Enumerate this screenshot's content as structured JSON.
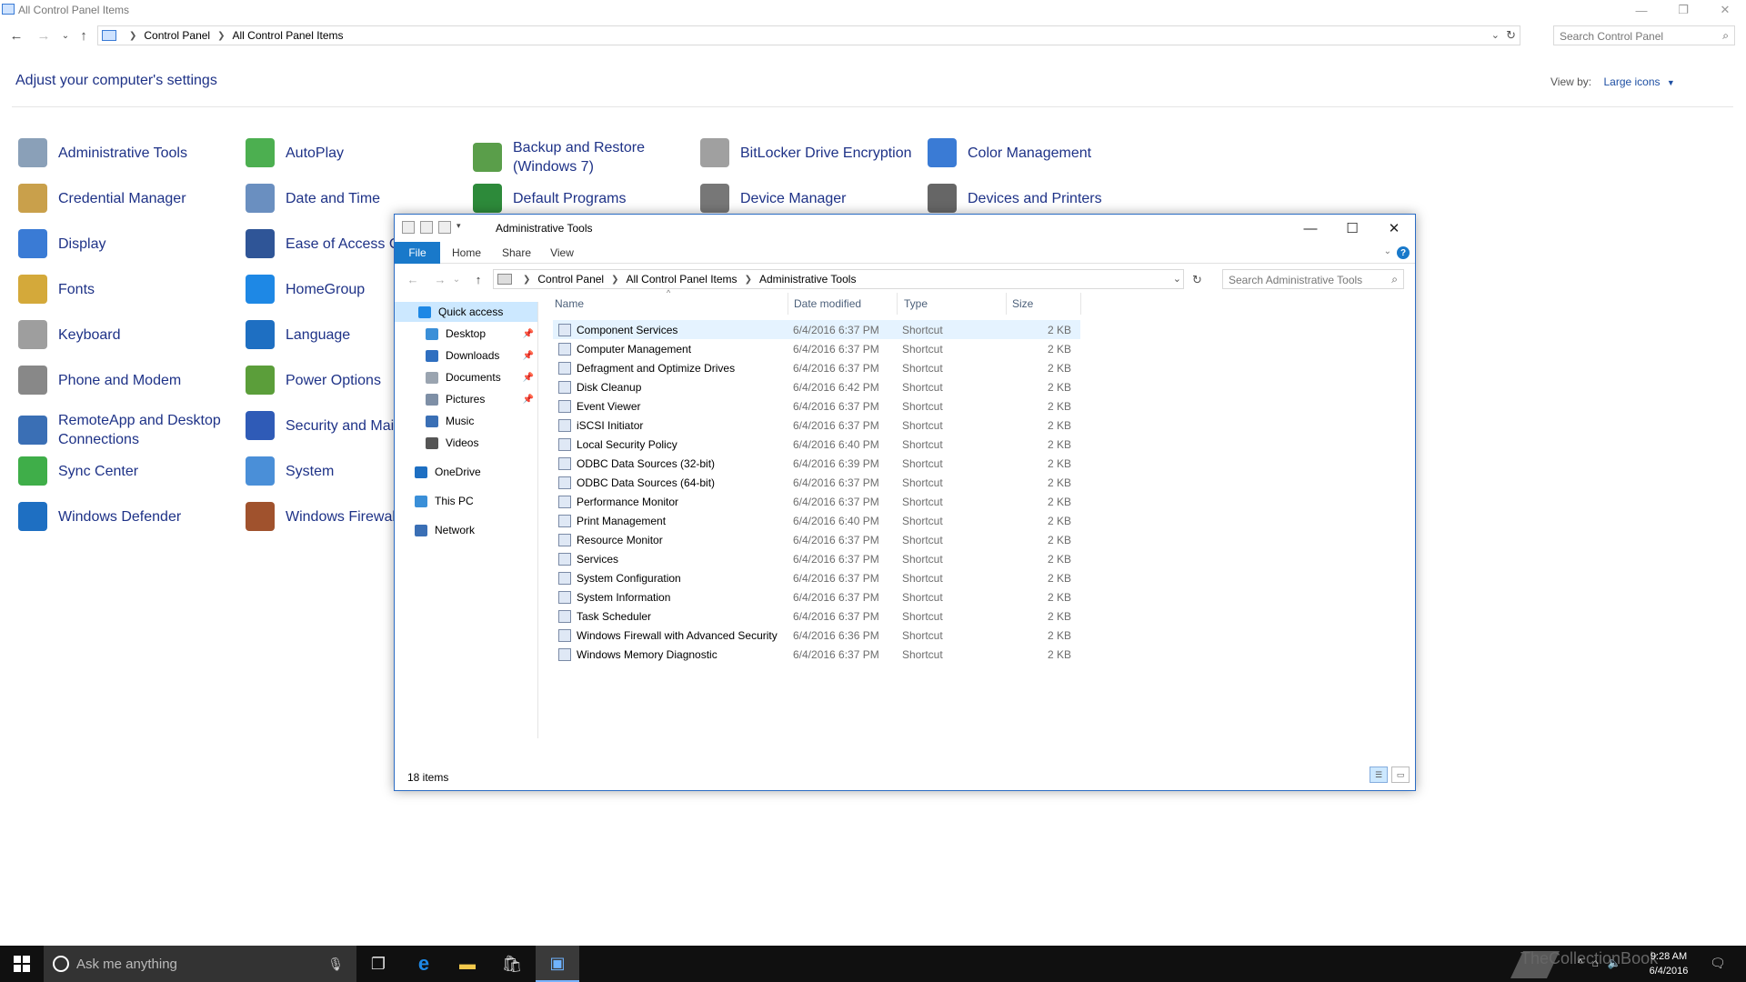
{
  "control_panel": {
    "title": "All Control Panel Items",
    "breadcrumb": [
      "Control Panel",
      "All Control Panel Items"
    ],
    "search_placeholder": "Search Control Panel",
    "heading": "Adjust your computer's settings",
    "view_by_label": "View by:",
    "view_by_value": "Large icons",
    "items": [
      {
        "label": "Administrative Tools",
        "icon": "admin-tools-icon",
        "color": "#8aa0b8"
      },
      {
        "label": "AutoPlay",
        "icon": "autoplay-icon",
        "color": "#4caf50"
      },
      {
        "label": "Backup and Restore\n(Windows 7)",
        "icon": "backup-icon",
        "color": "#5a9e4a"
      },
      {
        "label": "BitLocker Drive Encryption",
        "icon": "bitlocker-icon",
        "color": "#a0a0a0"
      },
      {
        "label": "Color Management",
        "icon": "color-management-icon",
        "color": "#3a7bd5"
      },
      {
        "label": "Credential Manager",
        "icon": "credential-manager-icon",
        "color": "#c9a04b"
      },
      {
        "label": "Date and Time",
        "icon": "date-time-icon",
        "color": "#6a8fc0"
      },
      {
        "label": "Default Programs",
        "icon": "default-programs-icon",
        "color": "#2d8a3a"
      },
      {
        "label": "Device Manager",
        "icon": "device-manager-icon",
        "color": "#777777"
      },
      {
        "label": "Devices and Printers",
        "icon": "devices-printers-icon",
        "color": "#666666"
      },
      {
        "label": "Display",
        "icon": "display-icon",
        "color": "#3a7bd5"
      },
      {
        "label": "Ease of Access Ce",
        "icon": "ease-of-access-icon",
        "color": "#2f5597"
      },
      {
        "label": "Fonts",
        "icon": "fonts-icon",
        "color": "#d4a93a"
      },
      {
        "label": "HomeGroup",
        "icon": "homegroup-icon",
        "color": "#1e88e5"
      },
      {
        "label": "Keyboard",
        "icon": "keyboard-icon",
        "color": "#9e9e9e"
      },
      {
        "label": "Language",
        "icon": "language-icon",
        "color": "#1e6fc2"
      },
      {
        "label": "Phone and Modem",
        "icon": "phone-modem-icon",
        "color": "#888888"
      },
      {
        "label": "Power Options",
        "icon": "power-options-icon",
        "color": "#5b9e3a"
      },
      {
        "label": "RemoteApp and Desktop\nConnections",
        "icon": "remoteapp-icon",
        "color": "#3a6fb5"
      },
      {
        "label": "Security and Main",
        "icon": "security-maintenance-icon",
        "color": "#2f5bb7"
      },
      {
        "label": "Sync Center",
        "icon": "sync-center-icon",
        "color": "#3fae49"
      },
      {
        "label": "System",
        "icon": "system-icon",
        "color": "#4a8fd8"
      },
      {
        "label": "Windows Defender",
        "icon": "windows-defender-icon",
        "color": "#1e6fc2"
      },
      {
        "label": "Windows Firewall",
        "icon": "windows-firewall-icon",
        "color": "#a0522d"
      }
    ]
  },
  "explorer": {
    "title": "Administrative Tools",
    "ribbon_tabs": [
      "File",
      "Home",
      "Share",
      "View"
    ],
    "breadcrumb": [
      "Control Panel",
      "All Control Panel Items",
      "Administrative Tools"
    ],
    "search_placeholder": "Search Administrative Tools",
    "nav": [
      {
        "label": "Quick access",
        "icon": "quick-access-icon",
        "color": "#1e88e5",
        "pinned": false
      },
      {
        "label": "Desktop",
        "icon": "desktop-icon",
        "color": "#3a8fd8",
        "pinned": true
      },
      {
        "label": "Downloads",
        "icon": "downloads-icon",
        "color": "#2f6fc0",
        "pinned": true
      },
      {
        "label": "Documents",
        "icon": "documents-icon",
        "color": "#9aa4b0",
        "pinned": true
      },
      {
        "label": "Pictures",
        "icon": "pictures-icon",
        "color": "#7e8fa6",
        "pinned": true
      },
      {
        "label": "Music",
        "icon": "music-icon",
        "color": "#3a6fb5",
        "pinned": false
      },
      {
        "label": "Videos",
        "icon": "videos-icon",
        "color": "#555555",
        "pinned": false
      },
      {
        "label": "OneDrive",
        "icon": "onedrive-icon",
        "color": "#1e6fc2",
        "pinned": false
      },
      {
        "label": "This PC",
        "icon": "this-pc-icon",
        "color": "#3a8fd8",
        "pinned": false
      },
      {
        "label": "Network",
        "icon": "network-icon",
        "color": "#3a6fb5",
        "pinned": false
      }
    ],
    "pin_glyph": "📌",
    "columns": [
      "Name",
      "Date modified",
      "Type",
      "Size"
    ],
    "files": [
      {
        "name": "Component Services",
        "date": "6/4/2016 6:37 PM",
        "type": "Shortcut",
        "size": "2 KB"
      },
      {
        "name": "Computer Management",
        "date": "6/4/2016 6:37 PM",
        "type": "Shortcut",
        "size": "2 KB"
      },
      {
        "name": "Defragment and Optimize Drives",
        "date": "6/4/2016 6:37 PM",
        "type": "Shortcut",
        "size": "2 KB"
      },
      {
        "name": "Disk Cleanup",
        "date": "6/4/2016 6:42 PM",
        "type": "Shortcut",
        "size": "2 KB"
      },
      {
        "name": "Event Viewer",
        "date": "6/4/2016 6:37 PM",
        "type": "Shortcut",
        "size": "2 KB"
      },
      {
        "name": "iSCSI Initiator",
        "date": "6/4/2016 6:37 PM",
        "type": "Shortcut",
        "size": "2 KB"
      },
      {
        "name": "Local Security Policy",
        "date": "6/4/2016 6:40 PM",
        "type": "Shortcut",
        "size": "2 KB"
      },
      {
        "name": "ODBC Data Sources (32-bit)",
        "date": "6/4/2016 6:39 PM",
        "type": "Shortcut",
        "size": "2 KB"
      },
      {
        "name": "ODBC Data Sources (64-bit)",
        "date": "6/4/2016 6:37 PM",
        "type": "Shortcut",
        "size": "2 KB"
      },
      {
        "name": "Performance Monitor",
        "date": "6/4/2016 6:37 PM",
        "type": "Shortcut",
        "size": "2 KB"
      },
      {
        "name": "Print Management",
        "date": "6/4/2016 6:40 PM",
        "type": "Shortcut",
        "size": "2 KB"
      },
      {
        "name": "Resource Monitor",
        "date": "6/4/2016 6:37 PM",
        "type": "Shortcut",
        "size": "2 KB"
      },
      {
        "name": "Services",
        "date": "6/4/2016 6:37 PM",
        "type": "Shortcut",
        "size": "2 KB"
      },
      {
        "name": "System Configuration",
        "date": "6/4/2016 6:37 PM",
        "type": "Shortcut",
        "size": "2 KB"
      },
      {
        "name": "System Information",
        "date": "6/4/2016 6:37 PM",
        "type": "Shortcut",
        "size": "2 KB"
      },
      {
        "name": "Task Scheduler",
        "date": "6/4/2016 6:37 PM",
        "type": "Shortcut",
        "size": "2 KB"
      },
      {
        "name": "Windows Firewall with Advanced Security",
        "date": "6/4/2016 6:36 PM",
        "type": "Shortcut",
        "size": "2 KB"
      },
      {
        "name": "Windows Memory Diagnostic",
        "date": "6/4/2016 6:37 PM",
        "type": "Shortcut",
        "size": "2 KB"
      }
    ],
    "selected_file": "Component Services",
    "status": "18 items"
  },
  "taskbar": {
    "search_placeholder": "Ask me anything",
    "clock_time": "9:28 AM",
    "clock_date": "6/4/2016",
    "watermark": "TheCollectionBook",
    "apps": [
      "task-view-icon",
      "edge-icon",
      "file-explorer-icon",
      "store-icon",
      "control-panel-icon"
    ],
    "active_app": "control-panel-icon"
  }
}
